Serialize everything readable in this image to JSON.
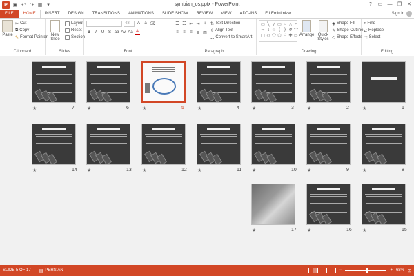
{
  "window": {
    "title": "symbian_os.pptx - PowerPoint",
    "app_logo": "P",
    "controls": [
      "?",
      "▭",
      "—",
      "❐",
      "✕"
    ]
  },
  "ribbon_tabs": [
    "FILE",
    "HOME",
    "INSERT",
    "DESIGN",
    "TRANSITIONS",
    "ANIMATIONS",
    "SLIDE SHOW",
    "REVIEW",
    "VIEW",
    "ADD-INS",
    "FILEminimizer"
  ],
  "active_tab": "HOME",
  "account": {
    "signin": "Sign in"
  },
  "clipboard": {
    "paste": "Paste",
    "cut": "Cut",
    "copy": "Copy",
    "format_painter": "Format Painter",
    "label": "Clipboard"
  },
  "slides_group": {
    "new_slide": "New Slide",
    "layout": "Layout",
    "reset": "Reset",
    "section": "Section",
    "label": "Slides"
  },
  "font_group": {
    "label": "Font",
    "size": "48",
    "buttons": [
      "B",
      "I",
      "U",
      "S",
      "ab",
      "AV",
      "Aa",
      "A"
    ]
  },
  "paragraph_group": {
    "label": "Paragraph",
    "text_direction": "Text Direction",
    "align_text": "Align Text",
    "convert_smartart": "Convert to SmartArt"
  },
  "drawing_group": {
    "label": "Drawing",
    "arrange": "Arrange",
    "quick_styles": "Quick Styles",
    "shape_fill": "Shape Fill",
    "shape_outline": "Shape Outline",
    "shape_effects": "Shape Effects",
    "shapes": [
      "▭",
      "╲",
      "╱",
      "▭",
      "○",
      "△",
      "⌐",
      "⇒",
      "⇓",
      "☆",
      "{",
      "}",
      "↺",
      "⌒",
      "▢",
      "◇",
      "⬠",
      "⬡",
      "⌂",
      "✚",
      "▷"
    ]
  },
  "editing_group": {
    "label": "Editing",
    "find": "Find",
    "replace": "Replace",
    "select": "Select"
  },
  "slides": [
    {
      "number": "1",
      "type": "title"
    },
    {
      "number": "2",
      "type": "text"
    },
    {
      "number": "3",
      "type": "text"
    },
    {
      "number": "4",
      "type": "text"
    },
    {
      "number": "5",
      "type": "diagram"
    },
    {
      "number": "6",
      "type": "text"
    },
    {
      "number": "7",
      "type": "text"
    },
    {
      "number": "8",
      "type": "text"
    },
    {
      "number": "9",
      "type": "text"
    },
    {
      "number": "10",
      "type": "text"
    },
    {
      "number": "11",
      "type": "text"
    },
    {
      "number": "12",
      "type": "text"
    },
    {
      "number": "13",
      "type": "text"
    },
    {
      "number": "14",
      "type": "text"
    },
    {
      "number": "15",
      "type": "text"
    },
    {
      "number": "16",
      "type": "text"
    },
    {
      "number": "17",
      "type": "photo"
    }
  ],
  "selected_slide": "5",
  "star_glyph": "★",
  "status": {
    "slide_info": "SLIDE 5 OF 17",
    "language": "PERSIAN",
    "zoom": "68%",
    "zoom_level": 0.68,
    "minus": "−",
    "plus": "+"
  },
  "colors": {
    "accent": "#d24726"
  }
}
